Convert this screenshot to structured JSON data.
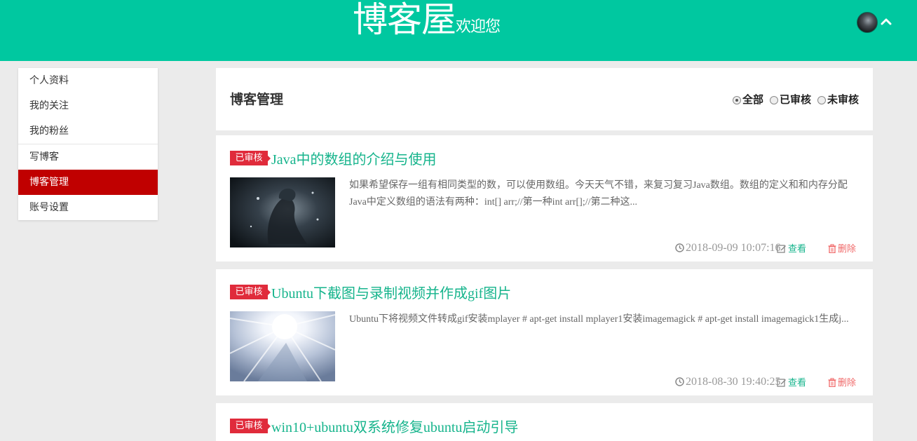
{
  "header": {
    "brand": "博客屋",
    "welcome": "欢迎您",
    "accent": "#00c8a0"
  },
  "sidebar": {
    "items": [
      {
        "label": "个人资料"
      },
      {
        "label": "我的关注"
      },
      {
        "label": "我的粉丝"
      },
      {
        "label": "写博客"
      },
      {
        "label": "博客管理",
        "active": true
      },
      {
        "label": "账号设置"
      }
    ]
  },
  "main": {
    "title": "博客管理",
    "filters": [
      {
        "label": "全部",
        "selected": true
      },
      {
        "label": "已审核",
        "selected": false
      },
      {
        "label": "未审核",
        "selected": false
      }
    ],
    "posts": [
      {
        "status": "已审核",
        "title": "Java中的数组的介绍与使用",
        "excerpt": "如果希望保存一组有相同类型的数，可以使用数组。今天天气不错，来复习复习Java数组。数组的定义和和内存分配Java中定义数组的语法有两种：int[] arr;//第一种int arr[];//第二种这...",
        "date": "2018-09-09 10:07:16",
        "view_label": "查看",
        "delete_label": "删除",
        "thumb": "dark-creature-image"
      },
      {
        "status": "已审核",
        "title": "Ubuntu下截图与录制视频并作成gif图片",
        "excerpt": "Ubuntu下将视频文件转成gif安装mplayer # apt-get install mplayer1安装imagemagick # apt-get install imagemagick1生成j...",
        "date": "2018-08-30 19:40:25",
        "view_label": "查看",
        "delete_label": "删除",
        "thumb": "light-burst-image"
      },
      {
        "status": "已审核",
        "title": "win10+ubuntu双系统修复ubuntu启动引导"
      }
    ]
  },
  "colors": {
    "status_badge": "#e02b3b",
    "active_menu": "#c00000",
    "title_link": "#16b48c",
    "delete": "#f06a6a"
  }
}
